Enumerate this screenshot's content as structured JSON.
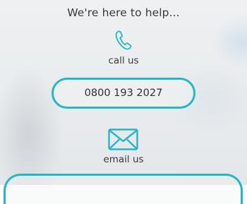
{
  "headline": "We're here to help...",
  "call": {
    "icon": "phone-icon",
    "label": "call us",
    "number": "0800 193 2027"
  },
  "email": {
    "icon": "envelope-icon",
    "label": "email us"
  },
  "colors": {
    "accent": "#27b6c6",
    "text": "#333333",
    "background": "#eceef0"
  }
}
